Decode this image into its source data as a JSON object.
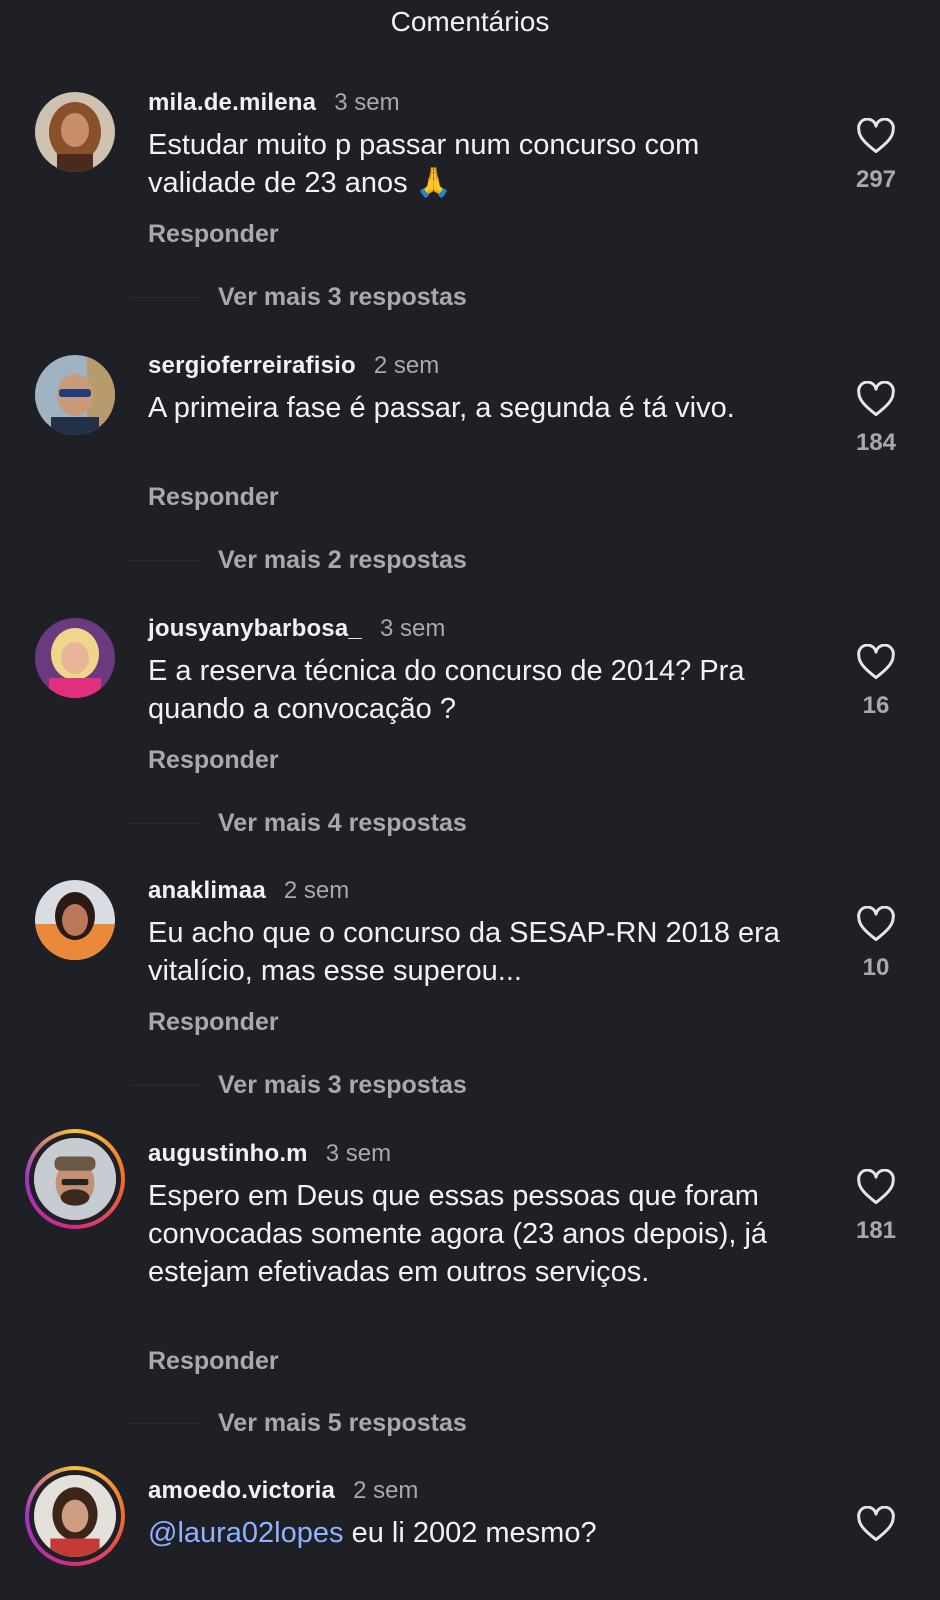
{
  "header": {
    "title": "Comentários"
  },
  "comments": [
    {
      "username": "mila.de.milena",
      "time": "3 sem",
      "text": "Estudar muito p passar num concurso com validade de 23 anos 🙏",
      "reply_label": "Responder",
      "likes": "297",
      "more_replies": "Ver mais 3 respostas"
    },
    {
      "username": "sergioferreirafisio",
      "time": "2 sem",
      "text": "A primeira fase é passar, a segunda é tá vivo.",
      "reply_label": "Responder",
      "likes": "184",
      "more_replies": "Ver mais 2 respostas"
    },
    {
      "username": "jousyanybarbosa_",
      "time": "3 sem",
      "text": "E a reserva técnica do concurso de 2014? Pra quando a convocação ?",
      "reply_label": "Responder",
      "likes": "16",
      "more_replies": "Ver mais 4 respostas"
    },
    {
      "username": "anaklimaa",
      "time": "2 sem",
      "text": "Eu acho que o concurso da SESAP-RN 2018 era vitalício, mas esse superou...",
      "reply_label": "Responder",
      "likes": "10",
      "more_replies": "Ver mais 3 respostas"
    },
    {
      "username": "augustinho.m",
      "time": "3 sem",
      "text": "Espero em Deus que essas pessoas que foram convocadas somente agora (23 anos depois), já estejam efetivadas em outros serviços.",
      "reply_label": "Responder",
      "likes": "181",
      "more_replies": "Ver mais 5 respostas"
    },
    {
      "username": "amoedo.victoria",
      "time": "2 sem",
      "mention": "@laura02lopes",
      "text": " eu li 2002 mesmo?"
    }
  ],
  "icons": {
    "like": "heart-outline-icon",
    "story_ring_colors": [
      "#f9c43a",
      "#f26b2b",
      "#d42d7c",
      "#9b35c6"
    ]
  }
}
